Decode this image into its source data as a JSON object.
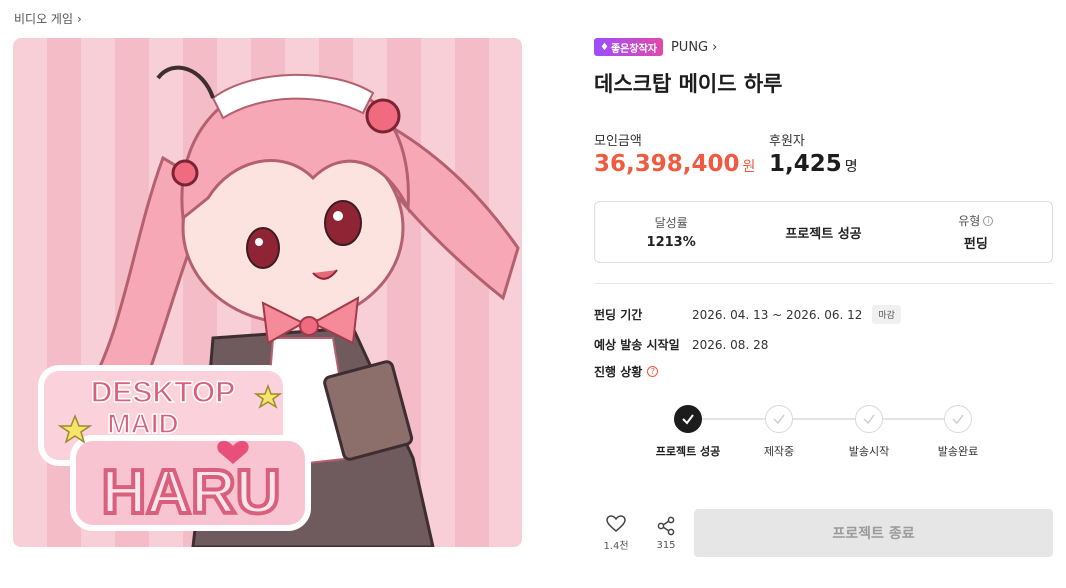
{
  "breadcrumb": {
    "category": "비디오 게임"
  },
  "creator": {
    "badge": "좋은창작자",
    "name": "PUNG"
  },
  "project": {
    "title": "데스크탑 메이드 하루"
  },
  "artwork": {
    "logo_line1": "DESKTOP",
    "logo_line2": "MAID",
    "logo_line3": "HARU"
  },
  "stats": {
    "raised_label": "모인금액",
    "raised_value": "36,398,400",
    "raised_unit": "원",
    "backers_label": "후원자",
    "backers_value": "1,425",
    "backers_unit": "명"
  },
  "summary": {
    "rate_label": "달성률",
    "rate_value": "1213%",
    "status": "프로젝트 성공",
    "type_label": "유형",
    "type_value": "펀딩"
  },
  "info": {
    "period_label": "펀딩 기간",
    "period_value": "2026. 04. 13 ~ 2026. 06. 12",
    "period_badge": "마감",
    "ship_label": "예상 발송 시작일",
    "ship_value": "2026. 08. 28",
    "progress_label": "진행 상황"
  },
  "progress_steps": [
    {
      "label": "프로젝트 성공",
      "done": true
    },
    {
      "label": "제작중",
      "done": false
    },
    {
      "label": "발송시작",
      "done": false
    },
    {
      "label": "발송완료",
      "done": false
    }
  ],
  "actions": {
    "like_count": "1.4천",
    "share_count": "315",
    "end_button": "프로젝트 종료"
  },
  "colors": {
    "accent_red": "#f05a3e",
    "badge_purple": "#9c4dff",
    "art_pink": "#f8cfd6"
  }
}
